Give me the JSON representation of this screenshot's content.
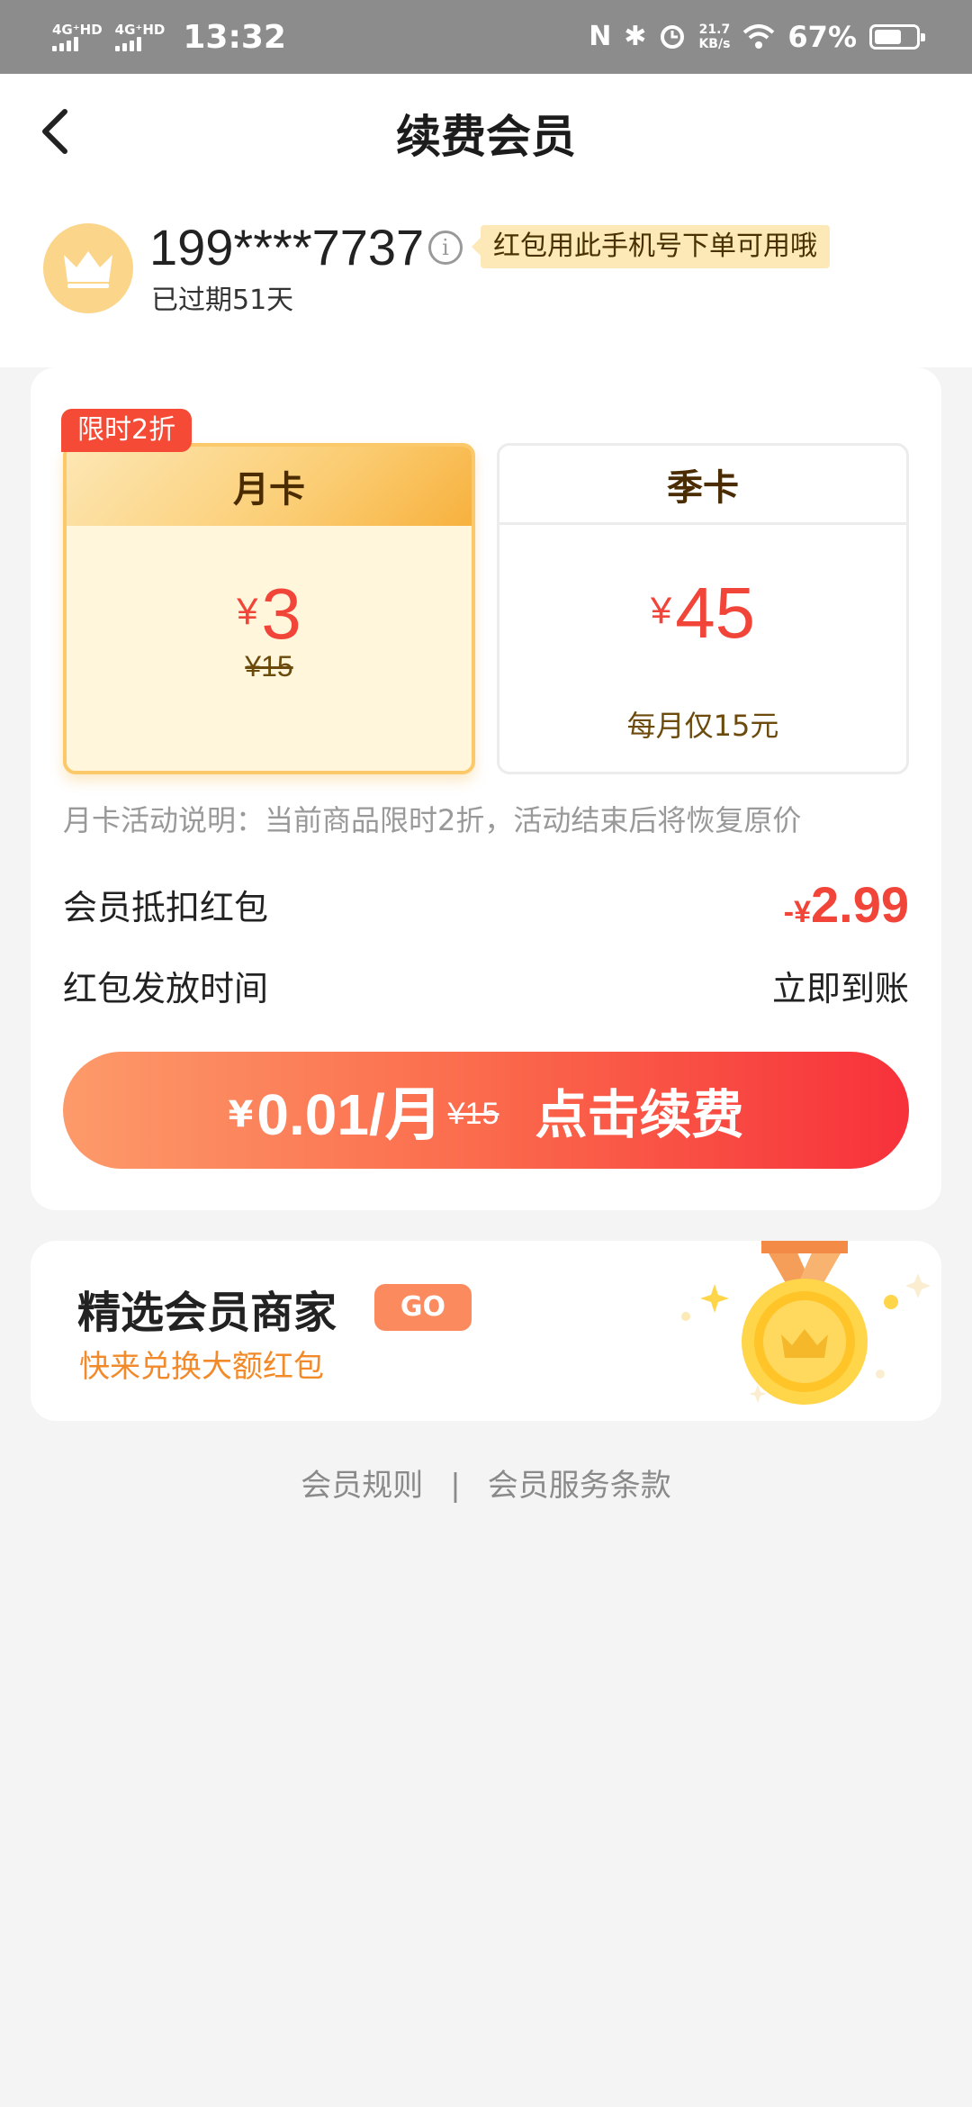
{
  "status_bar": {
    "network_1": "4G⁺HD",
    "network_2": "4G⁺HD",
    "time": "13:32",
    "nfc": "N",
    "bluetooth": "✱",
    "speed_value": "21.7",
    "speed_unit": "KB/s",
    "battery_percent": "67%",
    "battery_level": 0.67
  },
  "header": {
    "title": "续费会员"
  },
  "user": {
    "phone": "199****7737",
    "info_icon": "i",
    "tip": "红包用此手机号下单可用哦",
    "status": "已过期51天"
  },
  "plans": [
    {
      "badge": "限时2折",
      "name": "月卡",
      "currency": "¥",
      "price": "3",
      "original_price": "¥15"
    },
    {
      "name": "季卡",
      "currency": "¥",
      "price": "45",
      "note": "每月仅15元"
    }
  ],
  "description": "月卡活动说明：当前商品限时2折，活动结束后将恢复原价",
  "deduction": {
    "label": "会员抵扣红包",
    "prefix": "-",
    "currency": "¥",
    "value": "2.99"
  },
  "payout": {
    "label": "红包发放时间",
    "value": "立即到账"
  },
  "cta": {
    "currency": "¥",
    "price": "0.01/月",
    "original_price": "¥15",
    "label": "点击续费"
  },
  "merchant": {
    "title": "精选会员商家",
    "go": "GO",
    "subtitle": "快来兑换大额红包"
  },
  "footer": {
    "rules": "会员规则",
    "separator": "|",
    "terms": "会员服务条款"
  },
  "colors": {
    "accent_red": "#f2453a",
    "gold": "#fbc96a",
    "status_bar": "#8c8c8c"
  }
}
